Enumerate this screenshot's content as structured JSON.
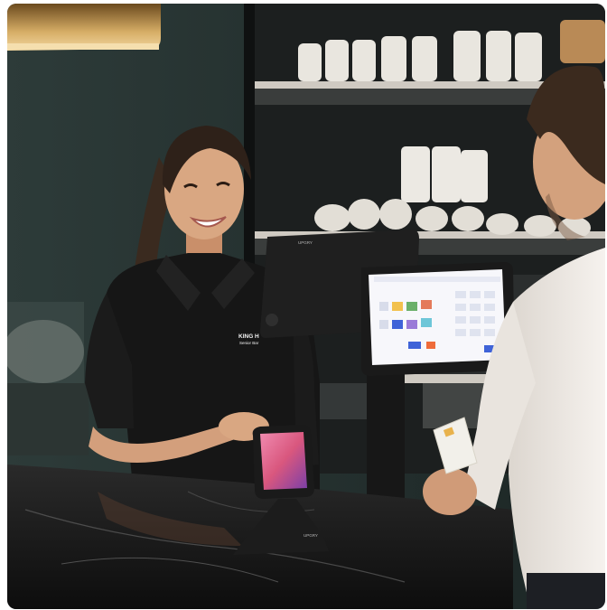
{
  "photo": {
    "badge_text": [
      "KING H",
      "Senior Bar"
    ],
    "brand_marks": [
      "UPGRY",
      "UPGRY"
    ],
    "colors": {
      "wall": "#23312f",
      "shelf_back": "#1b1d1d",
      "cups": "#e9e6df",
      "uniform": "#161616",
      "skin": "#d9a782",
      "marble_counter": "#151515",
      "pos_screen": "#f7f7fb",
      "pos_accent": "#3f63d8",
      "reader_screen": "#d9577e",
      "lamp": "#c9a05c",
      "customer_shirt": "#f1ede8"
    }
  }
}
